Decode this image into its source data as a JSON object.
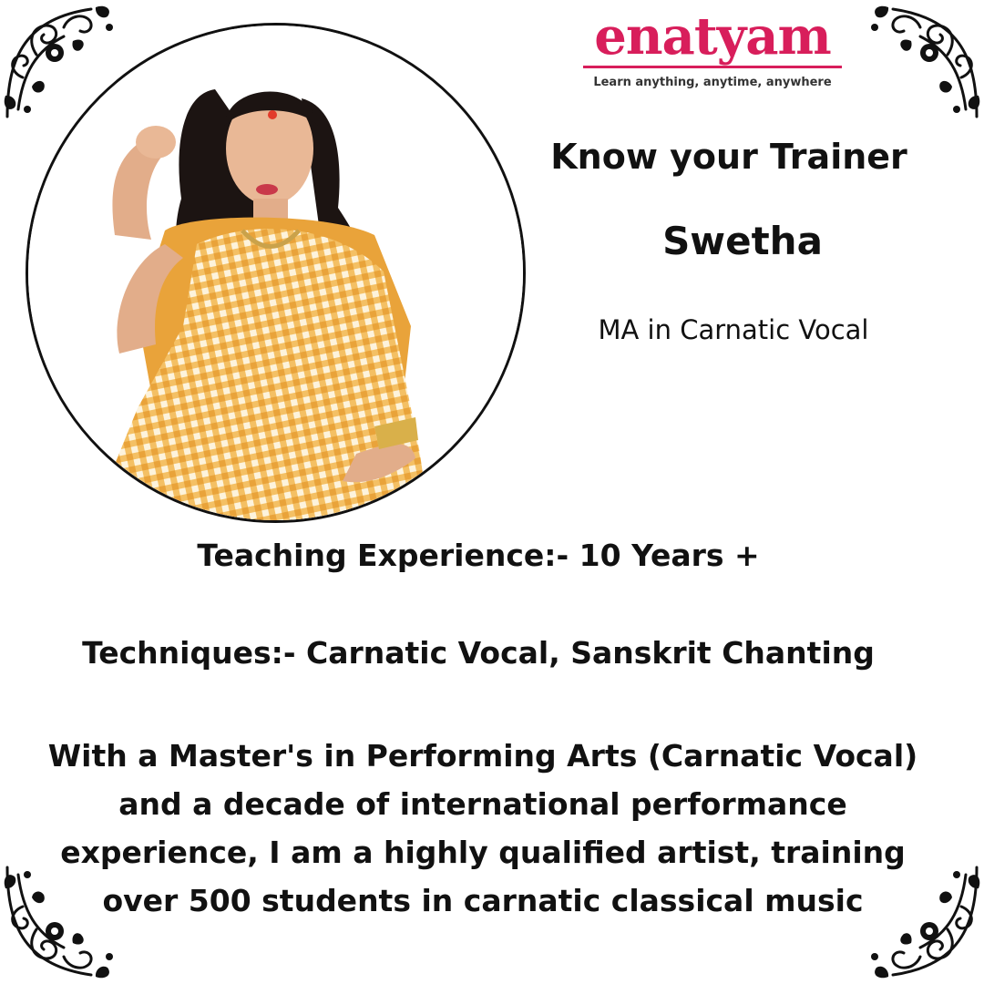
{
  "brand": {
    "logo_text": "enatyam",
    "tagline": "Learn anything, anytime, anywhere",
    "color": "#d81e5b"
  },
  "trainer": {
    "heading": "Know your Trainer",
    "name": "Swetha",
    "qualification": "MA in Carnatic Vocal"
  },
  "details": {
    "experience": "Teaching Experience:- 10 Years +",
    "techniques": "Techniques:- Carnatic Vocal, Sanskrit Chanting"
  },
  "bio": {
    "lines": [
      "With a Master's in Performing Arts (Carnatic Vocal)",
      "and a decade of international performance",
      "experience, I am a highly qualified artist, training",
      "over 500 students in carnatic classical music"
    ]
  },
  "decor": {
    "corner_ornament": "floral-swirl-ornament",
    "photo_icon": "trainer-portrait"
  }
}
